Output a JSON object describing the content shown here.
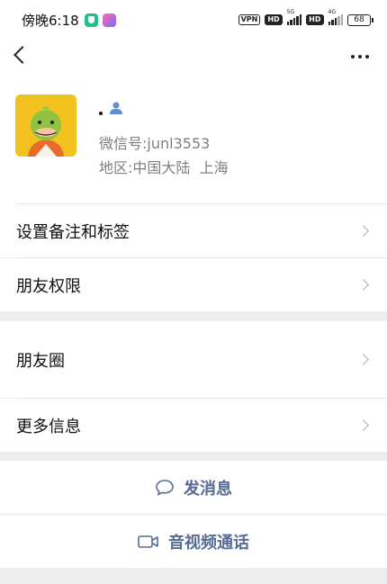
{
  "status_bar": {
    "time": "傍晚6:18",
    "vpn": "VPN",
    "hd1": "HD",
    "net1": "5G",
    "hd2": "HD",
    "net2": "4G",
    "battery": "68"
  },
  "nav": {
    "back_icon": "back-arrow-icon",
    "more_icon": "more-dots-icon"
  },
  "profile": {
    "nickname": "",
    "wechat_id_label": "微信号:",
    "wechat_id": "junl3553",
    "region_label": "地区:",
    "region": "中国大陆  上海"
  },
  "menu": {
    "remark_tags": "设置备注和标签",
    "friend_permissions": "朋友权限",
    "moments": "朋友圈",
    "more_info": "更多信息"
  },
  "actions": {
    "send_message": "发消息",
    "video_call": "音视频通话"
  },
  "colors": {
    "link_blue": "#576b95",
    "avatar_yellow": "#f4c21f",
    "background": "#ededed"
  }
}
